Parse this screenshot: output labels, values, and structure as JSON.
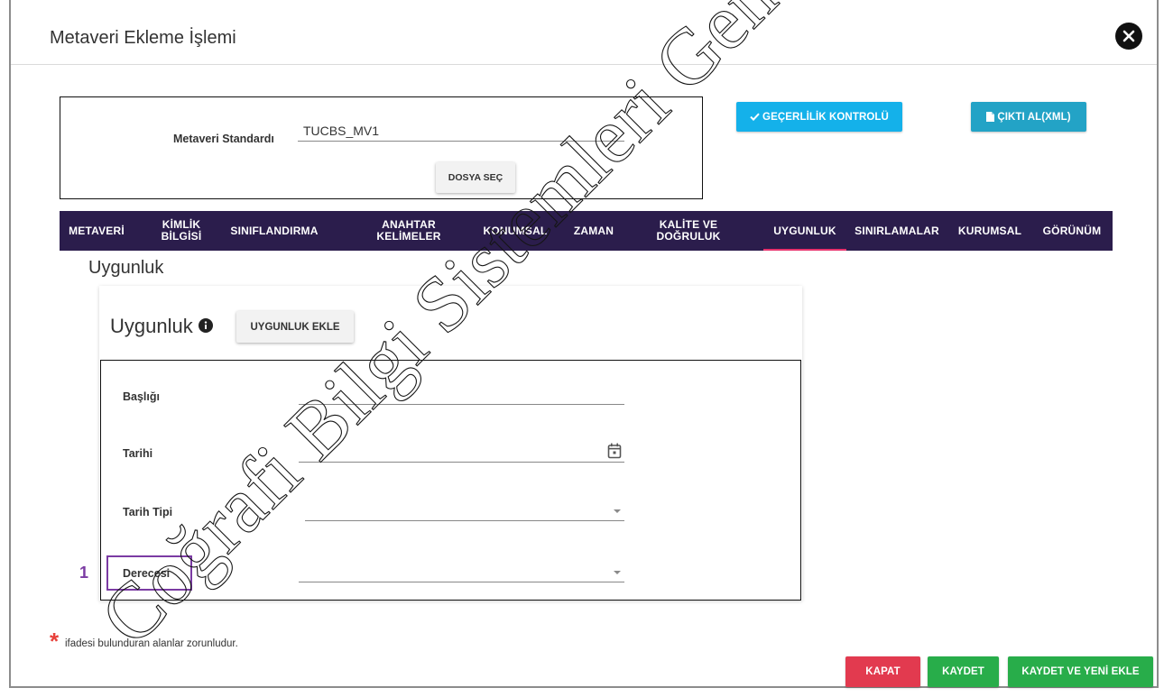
{
  "modal": {
    "title": "Metaveri Ekleme İşlemi",
    "close_icon": "close-icon"
  },
  "standard": {
    "label": "Metaveri Standardı",
    "value": "TUCBS_MV1",
    "file_button": "DOSYA SEÇ"
  },
  "toolbar": {
    "validate_label": "GEÇERLİLİK KONTROLÜ",
    "validate_icon": "check-icon",
    "export_label": "ÇIKTI AL(XML)",
    "export_icon": "file-icon"
  },
  "tabs": [
    {
      "lines": [
        "METAVERİ"
      ]
    },
    {
      "lines": [
        "KİMLİK",
        "BİLGİSİ"
      ]
    },
    {
      "lines": [
        "SINIFLANDIRMA"
      ]
    },
    {
      "lines": [
        "ANAHTAR",
        "KELİMELER"
      ]
    },
    {
      "lines": [
        "KONUMSAL"
      ]
    },
    {
      "lines": [
        "ZAMAN"
      ]
    },
    {
      "lines": [
        "KALİTE VE",
        "DOĞRULUK"
      ]
    },
    {
      "lines": [
        "UYGUNLUK"
      ],
      "active": true
    },
    {
      "lines": [
        "SINIRLAMALAR"
      ]
    },
    {
      "lines": [
        "KURUMSAL"
      ]
    },
    {
      "lines": [
        "GÖRÜNÜM"
      ]
    }
  ],
  "section": {
    "title": "Uygunluk"
  },
  "card": {
    "title": "Uygunluk",
    "info_icon": "info-icon",
    "add_button": "UYGUNLUK EKLE",
    "fields": [
      {
        "label": "Başlığı"
      },
      {
        "label": "Tarihi",
        "icon": "calendar-icon"
      },
      {
        "label": "Tarih Tipi",
        "icon": "chevron-down-icon"
      },
      {
        "label": "Derecesi",
        "icon": "chevron-down-icon"
      }
    ]
  },
  "annotation": {
    "number": "1"
  },
  "footer": {
    "required_mark": "*",
    "note": "ifadesi bulunduran alanlar zorunludur.",
    "close_button": "KAPAT",
    "save_button": "KAYDET",
    "save_new_button": "KAYDET VE YENİ EKLE"
  },
  "watermark": "Coğrafi Bilgi Sistemleri Gene",
  "colors": {
    "tab_bar": "#2b1d4c",
    "active_tab_indicator": "#e8336d",
    "validate_button": "#14b1ea",
    "export_button": "#23a3c6",
    "close_button": "#e23a4f",
    "save_button": "#28ad4a",
    "annotation": "#7b3ba3",
    "required_mark": "#e8413b"
  }
}
